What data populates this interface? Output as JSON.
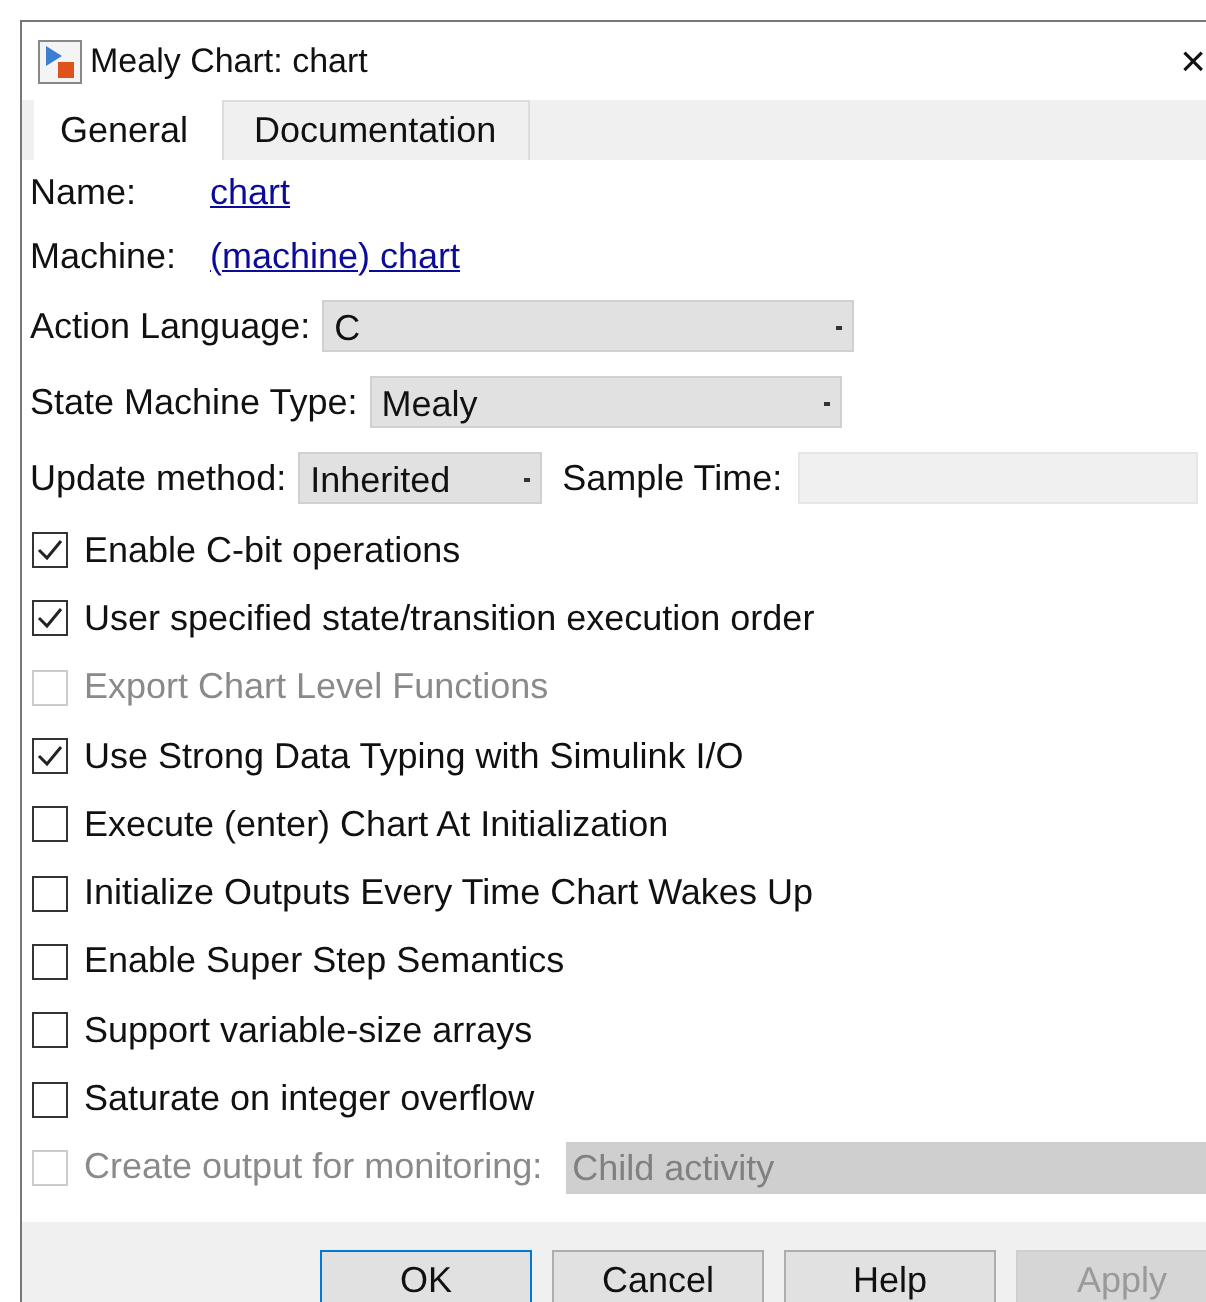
{
  "window": {
    "title": "Mealy Chart: chart",
    "close": "×"
  },
  "tabs": [
    {
      "label": "General",
      "selected": true
    },
    {
      "label": "Documentation",
      "selected": false
    }
  ],
  "name": {
    "label": "Name:",
    "link": "chart"
  },
  "machine": {
    "label": "Machine:",
    "link": "(machine) chart"
  },
  "action_language": {
    "label": "Action Language:",
    "value": "C"
  },
  "state_machine_type": {
    "label": "State Machine Type:",
    "value": "Mealy"
  },
  "update_method": {
    "label": "Update method:",
    "value": "Inherited"
  },
  "sample_time": {
    "label": "Sample Time:"
  },
  "options": [
    {
      "label": "Enable C-bit operations",
      "checked": true,
      "disabled": false
    },
    {
      "label": "User specified state/transition execution order",
      "checked": true,
      "disabled": false
    },
    {
      "label": "Export Chart Level Functions",
      "checked": false,
      "disabled": true
    },
    {
      "label": "Use Strong Data Typing with Simulink I/O",
      "checked": true,
      "disabled": false
    },
    {
      "label": "Execute (enter) Chart At Initialization",
      "checked": false,
      "disabled": false
    },
    {
      "label": "Initialize Outputs Every Time Chart Wakes Up",
      "checked": false,
      "disabled": false
    },
    {
      "label": "Enable Super Step Semantics",
      "checked": false,
      "disabled": false
    },
    {
      "label": "Support variable-size arrays",
      "checked": false,
      "disabled": false
    },
    {
      "label": "Saturate on integer overflow",
      "checked": false,
      "disabled": false
    }
  ],
  "monitoring": {
    "label": "Create output for monitoring:",
    "checked": false,
    "disabled": true,
    "value": "Child activity"
  },
  "buttons": [
    {
      "label": "OK",
      "disabled": false,
      "default": true
    },
    {
      "label": "Cancel",
      "disabled": false,
      "default": false
    },
    {
      "label": "Help",
      "disabled": false,
      "default": false
    },
    {
      "label": "Apply",
      "disabled": true,
      "default": false
    }
  ]
}
